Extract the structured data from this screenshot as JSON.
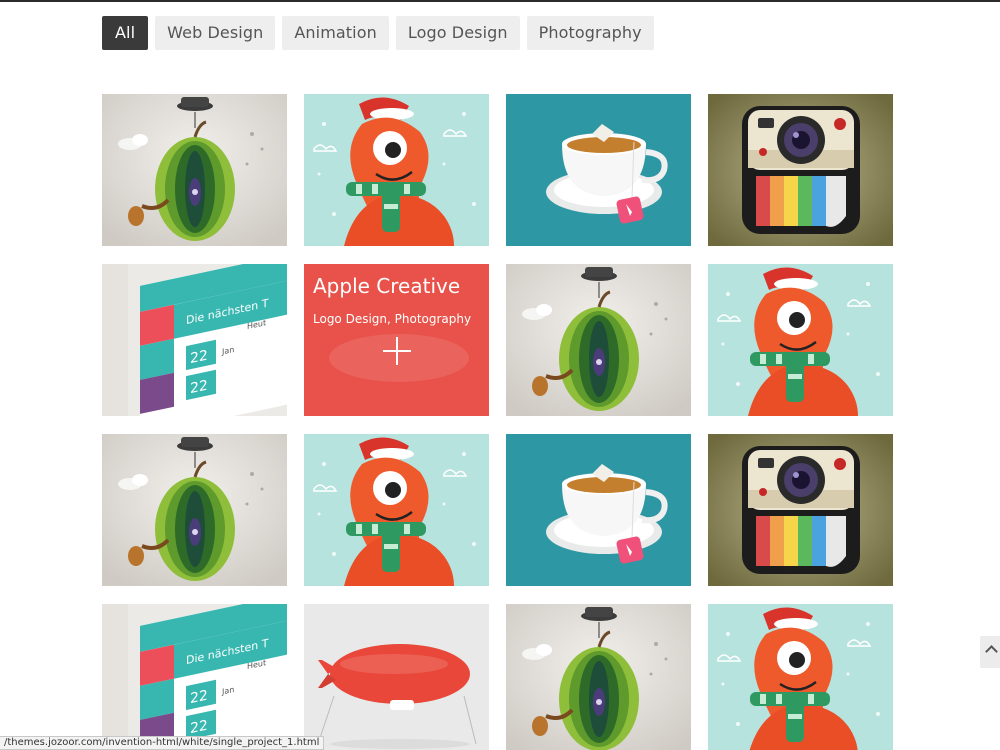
{
  "filters": [
    {
      "label": "All",
      "active": true
    },
    {
      "label": "Web Design",
      "active": false
    },
    {
      "label": "Animation",
      "active": false
    },
    {
      "label": "Logo Design",
      "active": false
    },
    {
      "label": "Photography",
      "active": false
    }
  ],
  "portfolio": {
    "tiles": [
      {
        "image": "apple-illustration"
      },
      {
        "image": "octopus-illustration"
      },
      {
        "image": "tea-cup-icon"
      },
      {
        "image": "instant-camera-icon"
      },
      {
        "image": "mobile-app-screenshot"
      },
      {
        "image": "blimp-illustration",
        "hovered": true,
        "title": "Apple Creative",
        "categories": "Logo Design, Photography"
      },
      {
        "image": "apple-illustration"
      },
      {
        "image": "octopus-illustration"
      },
      {
        "image": "apple-illustration"
      },
      {
        "image": "octopus-illustration"
      },
      {
        "image": "tea-cup-icon"
      },
      {
        "image": "instant-camera-icon"
      },
      {
        "image": "mobile-app-screenshot"
      },
      {
        "image": "blimp-illustration"
      },
      {
        "image": "apple-illustration"
      },
      {
        "image": "octopus-illustration"
      }
    ],
    "phone_mock_text": {
      "header": "Die nächsten T",
      "sub1": "Jan",
      "sub2": "Heut",
      "date": "22"
    }
  },
  "status_bar": {
    "url": "/themes.jozoor.com/invention-html/white/single_project_1.html"
  },
  "colors": {
    "overlay": "#e8524a",
    "active_filter": "#3a3a3a",
    "filter_bg": "#eeeeee"
  }
}
